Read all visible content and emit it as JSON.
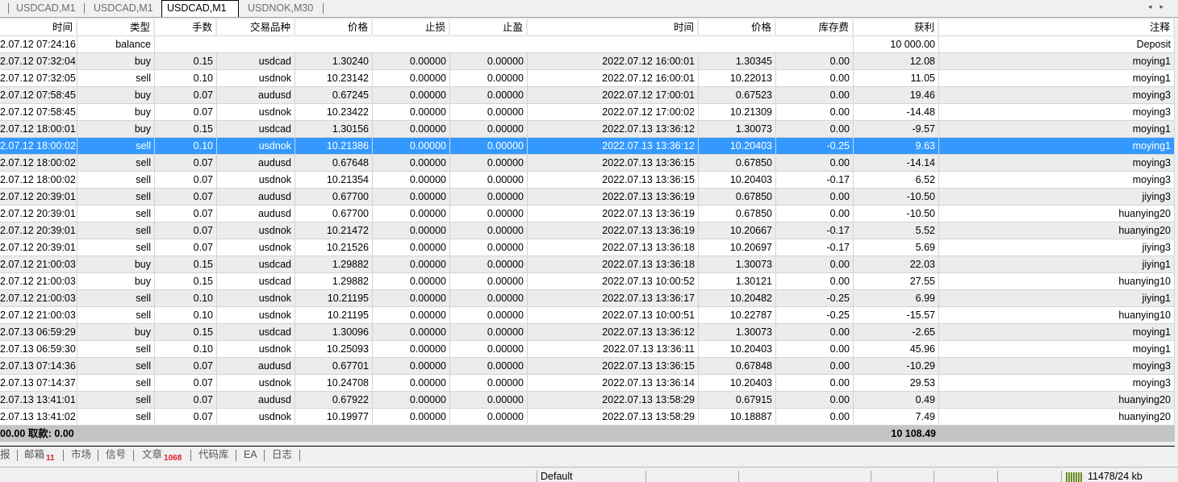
{
  "chart_tabs": [
    "USDCAD,M1",
    "USDCAD,M1",
    "USDCAD,M1",
    "USDNOK,M30"
  ],
  "active_tab": 2,
  "columns": [
    "时间",
    "类型",
    "手数",
    "交易品种",
    "价格",
    "止损",
    "止盈",
    "时间",
    "价格",
    "库存费",
    "获利",
    "注释"
  ],
  "balance_row": {
    "time": "2.07.12 07:24:16",
    "type": "balance",
    "profit": "10 000.00",
    "comment": "Deposit"
  },
  "rows": [
    [
      "2.07.12 07:32:04",
      "buy",
      "0.15",
      "usdcad",
      "1.30240",
      "0.00000",
      "0.00000",
      "2022.07.12 16:00:01",
      "1.30345",
      "0.00",
      "12.08",
      "moying1"
    ],
    [
      "2.07.12 07:32:05",
      "sell",
      "0.10",
      "usdnok",
      "10.23142",
      "0.00000",
      "0.00000",
      "2022.07.12 16:00:01",
      "10.22013",
      "0.00",
      "11.05",
      "moying1"
    ],
    [
      "2.07.12 07:58:45",
      "buy",
      "0.07",
      "audusd",
      "0.67245",
      "0.00000",
      "0.00000",
      "2022.07.12 17:00:01",
      "0.67523",
      "0.00",
      "19.46",
      "moying3"
    ],
    [
      "2.07.12 07:58:45",
      "buy",
      "0.07",
      "usdnok",
      "10.23422",
      "0.00000",
      "0.00000",
      "2022.07.12 17:00:02",
      "10.21309",
      "0.00",
      "-14.48",
      "moying3"
    ],
    [
      "2.07.12 18:00:01",
      "buy",
      "0.15",
      "usdcad",
      "1.30156",
      "0.00000",
      "0.00000",
      "2022.07.13 13:36:12",
      "1.30073",
      "0.00",
      "-9.57",
      "moying1"
    ],
    [
      "2.07.12 18:00:02",
      "sell",
      "0.10",
      "usdnok",
      "10.21386",
      "0.00000",
      "0.00000",
      "2022.07.13 13:36:12",
      "10.20403",
      "-0.25",
      "9.63",
      "moying1"
    ],
    [
      "2.07.12 18:00:02",
      "sell",
      "0.07",
      "audusd",
      "0.67648",
      "0.00000",
      "0.00000",
      "2022.07.13 13:36:15",
      "0.67850",
      "0.00",
      "-14.14",
      "moying3"
    ],
    [
      "2.07.12 18:00:02",
      "sell",
      "0.07",
      "usdnok",
      "10.21354",
      "0.00000",
      "0.00000",
      "2022.07.13 13:36:15",
      "10.20403",
      "-0.17",
      "6.52",
      "moying3"
    ],
    [
      "2.07.12 20:39:01",
      "sell",
      "0.07",
      "audusd",
      "0.67700",
      "0.00000",
      "0.00000",
      "2022.07.13 13:36:19",
      "0.67850",
      "0.00",
      "-10.50",
      "jiying3"
    ],
    [
      "2.07.12 20:39:01",
      "sell",
      "0.07",
      "audusd",
      "0.67700",
      "0.00000",
      "0.00000",
      "2022.07.13 13:36:19",
      "0.67850",
      "0.00",
      "-10.50",
      "huanying20"
    ],
    [
      "2.07.12 20:39:01",
      "sell",
      "0.07",
      "usdnok",
      "10.21472",
      "0.00000",
      "0.00000",
      "2022.07.13 13:36:19",
      "10.20667",
      "-0.17",
      "5.52",
      "huanying20"
    ],
    [
      "2.07.12 20:39:01",
      "sell",
      "0.07",
      "usdnok",
      "10.21526",
      "0.00000",
      "0.00000",
      "2022.07.13 13:36:18",
      "10.20697",
      "-0.17",
      "5.69",
      "jiying3"
    ],
    [
      "2.07.12 21:00:03",
      "buy",
      "0.15",
      "usdcad",
      "1.29882",
      "0.00000",
      "0.00000",
      "2022.07.13 13:36:18",
      "1.30073",
      "0.00",
      "22.03",
      "jiying1"
    ],
    [
      "2.07.12 21:00:03",
      "buy",
      "0.15",
      "usdcad",
      "1.29882",
      "0.00000",
      "0.00000",
      "2022.07.13 10:00:52",
      "1.30121",
      "0.00",
      "27.55",
      "huanying10"
    ],
    [
      "2.07.12 21:00:03",
      "sell",
      "0.10",
      "usdnok",
      "10.21195",
      "0.00000",
      "0.00000",
      "2022.07.13 13:36:17",
      "10.20482",
      "-0.25",
      "6.99",
      "jiying1"
    ],
    [
      "2.07.12 21:00:03",
      "sell",
      "0.10",
      "usdnok",
      "10.21195",
      "0.00000",
      "0.00000",
      "2022.07.13 10:00:51",
      "10.22787",
      "-0.25",
      "-15.57",
      "huanying10"
    ],
    [
      "2.07.13 06:59:29",
      "buy",
      "0.15",
      "usdcad",
      "1.30096",
      "0.00000",
      "0.00000",
      "2022.07.13 13:36:12",
      "1.30073",
      "0.00",
      "-2.65",
      "moying1"
    ],
    [
      "2.07.13 06:59:30",
      "sell",
      "0.10",
      "usdnok",
      "10.25093",
      "0.00000",
      "0.00000",
      "2022.07.13 13:36:11",
      "10.20403",
      "0.00",
      "45.96",
      "moying1"
    ],
    [
      "2.07.13 07:14:36",
      "sell",
      "0.07",
      "audusd",
      "0.67701",
      "0.00000",
      "0.00000",
      "2022.07.13 13:36:15",
      "0.67848",
      "0.00",
      "-10.29",
      "moying3"
    ],
    [
      "2.07.13 07:14:37",
      "sell",
      "0.07",
      "usdnok",
      "10.24708",
      "0.00000",
      "0.00000",
      "2022.07.13 13:36:14",
      "10.20403",
      "0.00",
      "29.53",
      "moying3"
    ],
    [
      "2.07.13 13:41:01",
      "sell",
      "0.07",
      "audusd",
      "0.67922",
      "0.00000",
      "0.00000",
      "2022.07.13 13:58:29",
      "0.67915",
      "0.00",
      "0.49",
      "huanying20"
    ],
    [
      "2.07.13 13:41:02",
      "sell",
      "0.07",
      "usdnok",
      "10.19977",
      "0.00000",
      "0.00000",
      "2022.07.13 13:58:29",
      "10.18887",
      "0.00",
      "7.49",
      "huanying20"
    ]
  ],
  "selected_row": 5,
  "summary": {
    "left": "00.00  取款: 0.00",
    "total": "10 108.49"
  },
  "bottom_tabs": [
    {
      "label": "报"
    },
    {
      "label": "邮箱",
      "badge": "11"
    },
    {
      "label": "市场"
    },
    {
      "label": "信号"
    },
    {
      "label": "文章",
      "badge": "1068"
    },
    {
      "label": "代码库"
    },
    {
      "label": "EA"
    },
    {
      "label": "日志"
    }
  ],
  "status": {
    "profile": "Default",
    "memory": "11478/24 kb"
  },
  "colors": {
    "selection": "#3399ff",
    "badge": "#e0202a"
  }
}
